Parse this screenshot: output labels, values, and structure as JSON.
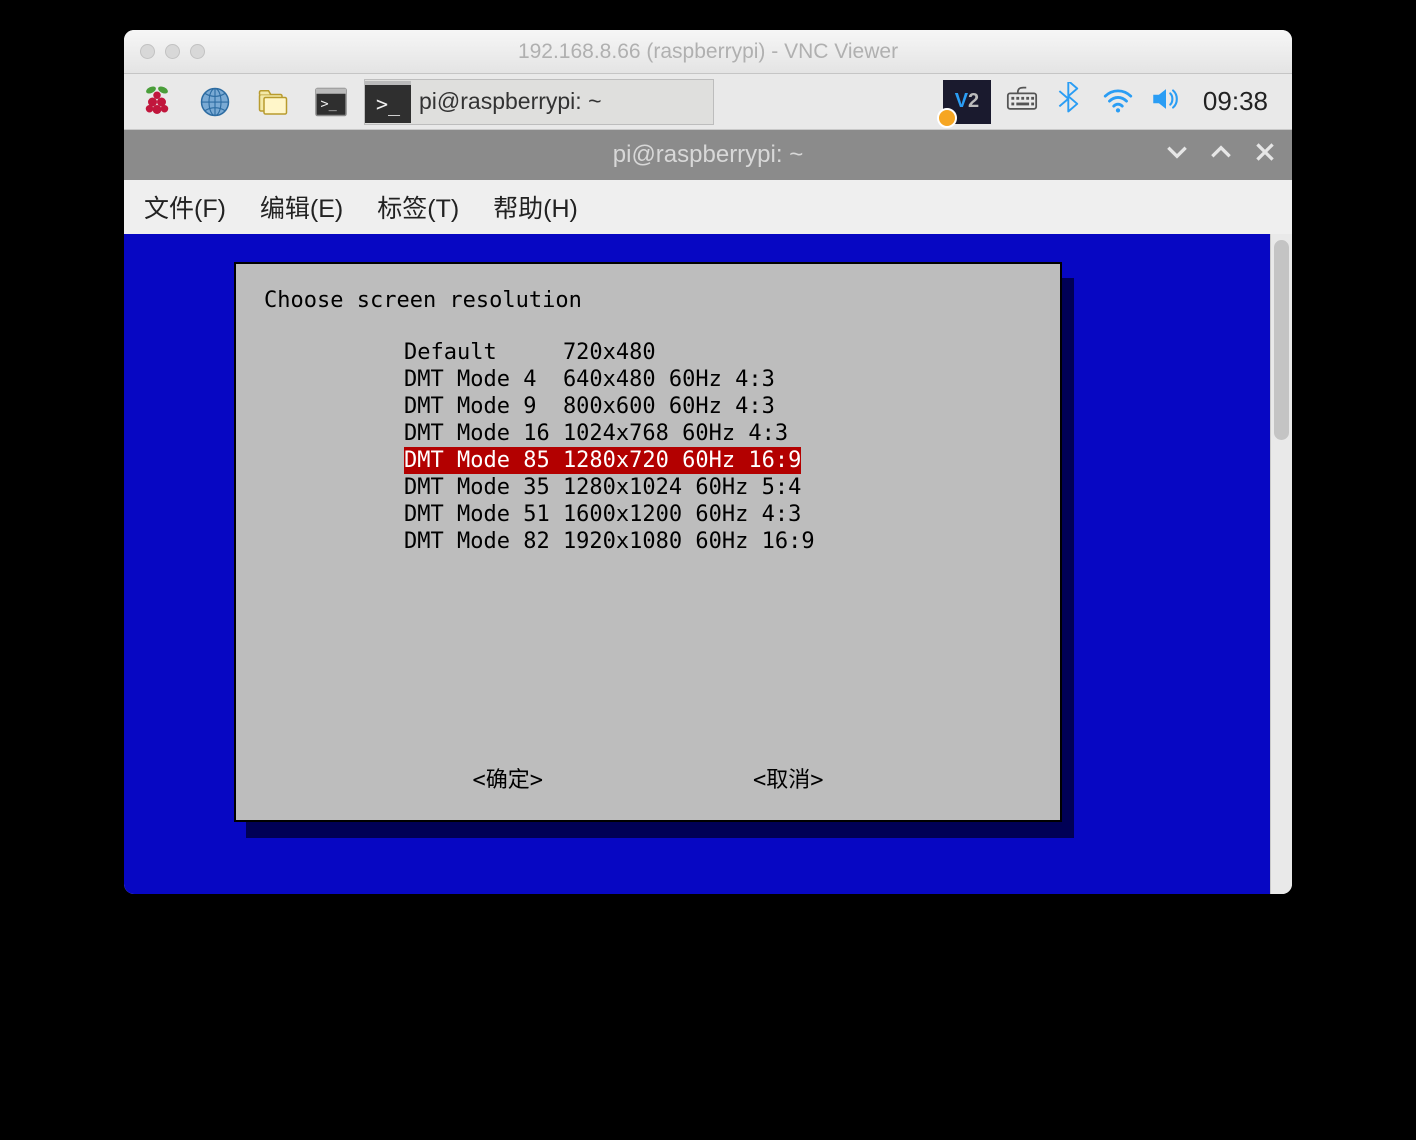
{
  "mac_title": "192.168.8.66 (raspberrypi) - VNC Viewer",
  "taskbar": {
    "task_label": "pi@raspberrypi: ~",
    "clock": "09:38"
  },
  "win_title": "pi@raspberrypi: ~",
  "menubar": {
    "file": "文件(F)",
    "edit": "编辑(E)",
    "tabs": "标签(T)",
    "help": "帮助(H)"
  },
  "dialog": {
    "title": "Choose screen resolution",
    "options": [
      {
        "text": "Default     720x480",
        "selected": false
      },
      {
        "text": "DMT Mode 4  640x480 60Hz 4:3",
        "selected": false
      },
      {
        "text": "DMT Mode 9  800x600 60Hz 4:3",
        "selected": false
      },
      {
        "text": "DMT Mode 16 1024x768 60Hz 4:3",
        "selected": false
      },
      {
        "text": "DMT Mode 85 1280x720 60Hz 16:9",
        "selected": true
      },
      {
        "text": "DMT Mode 35 1280x1024 60Hz 5:4",
        "selected": false
      },
      {
        "text": "DMT Mode 51 1600x1200 60Hz 4:3",
        "selected": false
      },
      {
        "text": "DMT Mode 82 1920x1080 60Hz 16:9",
        "selected": false
      }
    ],
    "ok": "<确定>",
    "cancel": "<取消>"
  }
}
